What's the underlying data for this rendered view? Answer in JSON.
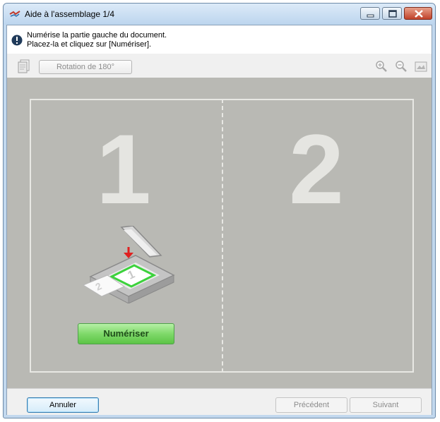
{
  "window": {
    "title": "Aide à l'assemblage 1/4"
  },
  "info": {
    "line1": "Numérise la partie gauche du document.",
    "line2": "Placez-la et cliquez sur [Numériser]."
  },
  "toolbar": {
    "rotate_label": "Rotation de 180°",
    "icons": [
      "document-icon",
      "zoom-in-icon",
      "zoom-out-icon",
      "fit-page-icon"
    ]
  },
  "canvas": {
    "left_page_number": "1",
    "right_page_number": "2",
    "scan_button_label": "Numériser"
  },
  "footer": {
    "cancel_label": "Annuler",
    "previous_label": "Précédent",
    "next_label": "Suivant"
  },
  "colors": {
    "canvas_bg": "#b9b9b4",
    "scan_button": "#7fd96a",
    "info_icon": "#1f3a5a"
  }
}
